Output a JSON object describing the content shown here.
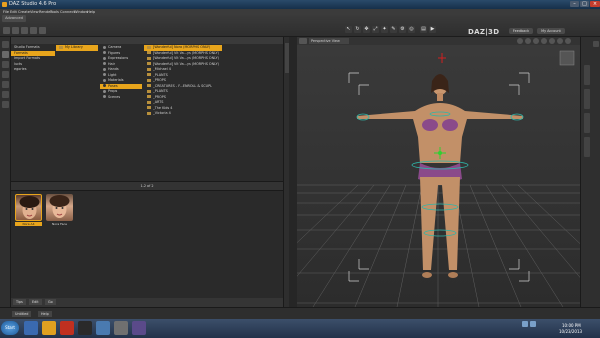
{
  "window": {
    "title": "DAZ Studio 4.6 Pro"
  },
  "menu": [
    "File",
    "Edit",
    "Create",
    "View",
    "Render",
    "Tools",
    "Connect",
    "Window",
    "Help"
  ],
  "toolbar": {
    "tab": "Advanced",
    "logo": "DAZ|3D",
    "buttons": [
      "Feedback",
      "My Account"
    ]
  },
  "content": {
    "col1": [
      "Studio Formats",
      "Formats",
      "Import Formats",
      "lucts",
      "egories"
    ],
    "col2": [
      "My Library"
    ],
    "col3": [
      "Camera",
      "Figures",
      "Expressions",
      "Hair",
      "Hands",
      "Light",
      "Materials",
      "Poses",
      "Props",
      "Scenes"
    ],
    "col4": [
      "[Wonderful] Nora (MORPHS ONLY)",
      "[Wonderful] Vit Va...ys (MORPHS ONLY)",
      "[Wonderful] Vit Va...ys (MORPHS ONLY)",
      "[Wonderful] Vit Va...ys (MORPHS ONLY)",
      "_Michael 4",
      "_PLANTS",
      "_PROPS",
      "_CREATURES - F...ENROLL & SCUPL",
      "_PLANTS",
      "_PROPS",
      "_ARTS",
      "_The Kids 4",
      "_Victoria 4"
    ],
    "selected_col3": "Poses",
    "selected_col4": "[Wonderful] Nora (MORPHS ONLY)",
    "divider_label": "1-2 of 2"
  },
  "thumbs": [
    {
      "caption": "Nora A4"
    },
    {
      "caption": "Nora Face"
    }
  ],
  "bottomtabs": [
    "Tips",
    "Edit",
    "Go"
  ],
  "viewport": {
    "label": "Perspective View"
  },
  "statusbar": {
    "tabs": [
      "Untitled",
      "Help"
    ]
  },
  "taskbar": {
    "start": "Start",
    "time": "10:00 PM",
    "date": "10/23/2013"
  }
}
